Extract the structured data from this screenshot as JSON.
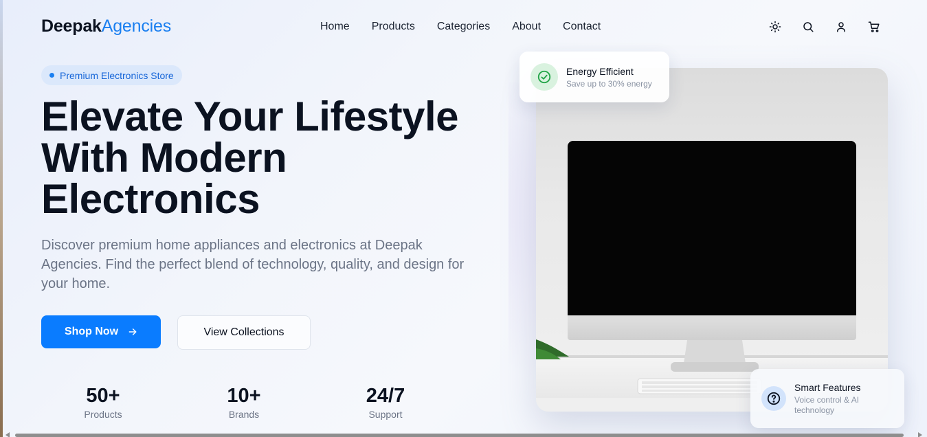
{
  "header": {
    "logo_part1": "Deepak",
    "logo_part2": "Agencies",
    "nav": [
      "Home",
      "Products",
      "Categories",
      "About",
      "Contact"
    ],
    "icons": [
      "sun-icon",
      "search-icon",
      "user-icon",
      "cart-icon"
    ]
  },
  "hero": {
    "badge": "Premium Electronics Store",
    "title": "Elevate Your Lifestyle With Modern Electronics",
    "subtitle": "Discover premium home appliances and electronics at Deepak Agencies. Find the perfect blend of technology, quality, and design for your home.",
    "primary_button": "Shop Now",
    "secondary_button": "View Collections",
    "stats": [
      {
        "value": "50+",
        "label": "Products"
      },
      {
        "value": "10+",
        "label": "Brands"
      },
      {
        "value": "24/7",
        "label": "Support"
      }
    ]
  },
  "feature_cards": {
    "energy": {
      "title": "Energy Efficient",
      "subtitle": "Save up to 30% energy",
      "icon": "check-circle-icon"
    },
    "smart": {
      "title": "Smart Features",
      "subtitle": "Voice control & AI technology",
      "icon": "help-circle-icon"
    }
  },
  "colors": {
    "accent": "#0a7cff",
    "logo_accent": "#1a7ff0",
    "title": "#0b1220",
    "muted": "#6b7486",
    "energy_green": "#22a447"
  }
}
